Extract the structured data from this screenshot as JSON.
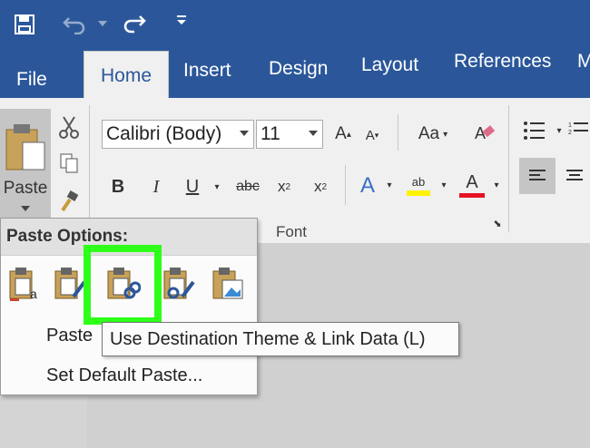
{
  "quick_access": {
    "save_icon": "save-icon",
    "undo_icon": "undo-icon",
    "redo_icon": "redo-icon",
    "customize_icon": "customize-qat-icon"
  },
  "tabs": [
    {
      "label": "File"
    },
    {
      "label": "Home"
    },
    {
      "label": "Insert"
    },
    {
      "label": "Design"
    },
    {
      "label": "Layout"
    },
    {
      "label": "References"
    },
    {
      "label": "M"
    }
  ],
  "clipboard": {
    "paste_label": "Paste"
  },
  "font": {
    "name": "Calibri (Body)",
    "size": "11",
    "group_label": "Font"
  },
  "paste_menu": {
    "header": "Paste Options:",
    "options": [
      {
        "icon": "keep-source-formatting-icon"
      },
      {
        "icon": "use-destination-styles-icon"
      },
      {
        "icon": "use-destination-theme-link-data-icon"
      },
      {
        "icon": "keep-source-formatting-link-data-icon"
      },
      {
        "icon": "picture-icon"
      }
    ],
    "paste_special": "Paste",
    "set_default": "Set Default Paste..."
  },
  "tooltip": "Use Destination Theme & Link Data (L)",
  "colors": {
    "accent": "#2b579a",
    "highlight": "#2dff19",
    "font_color_bar": "#e81123",
    "highlight_bar": "#fff200"
  }
}
